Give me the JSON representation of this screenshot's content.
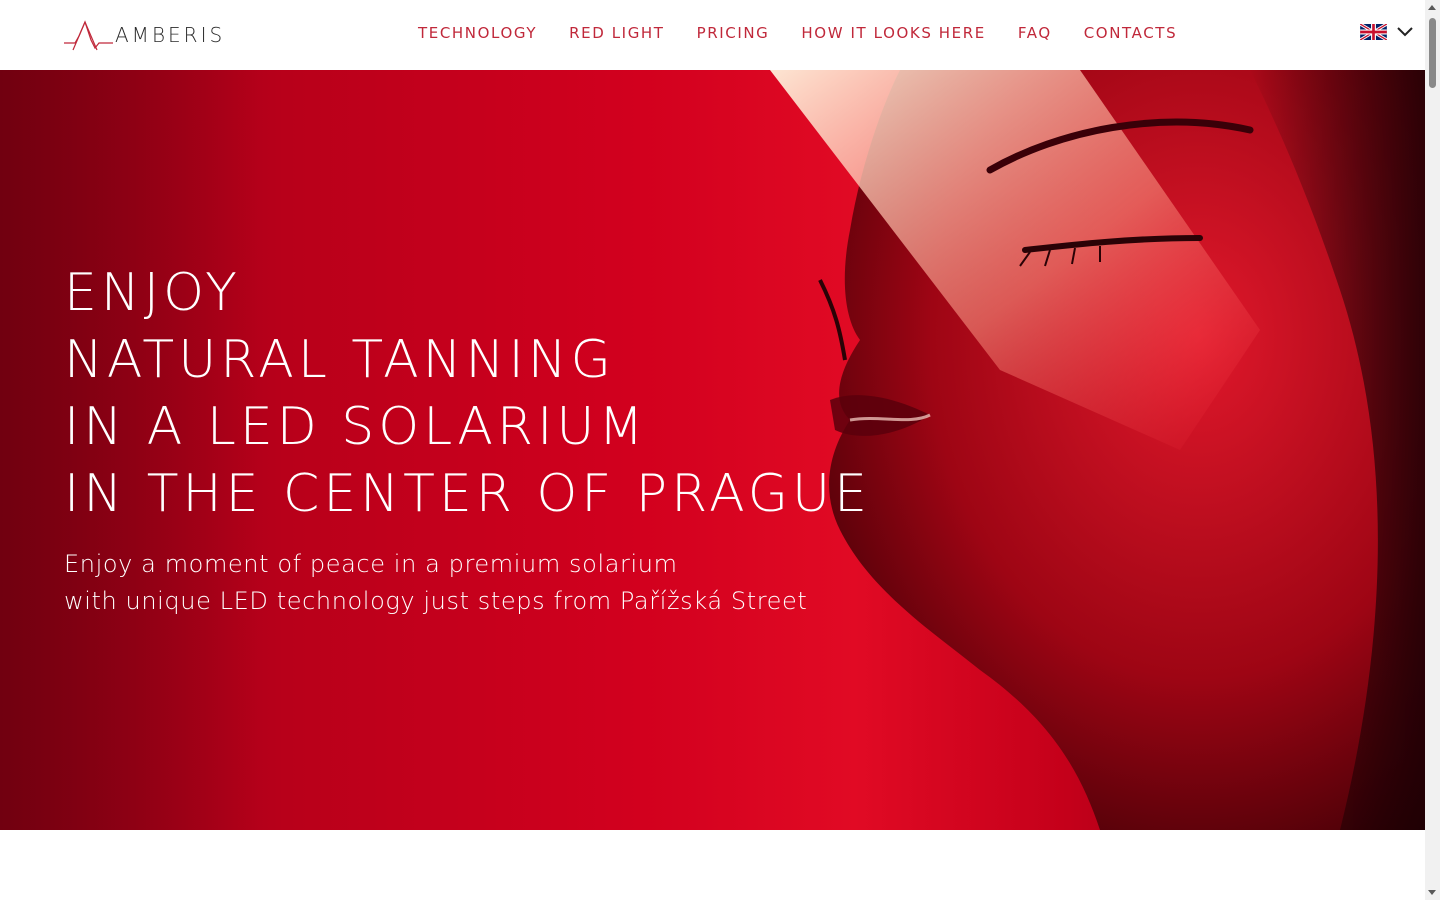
{
  "brand": {
    "name": "AMBERIS",
    "accent_color": "#c0283a",
    "logo_icon": "amberis-logo-icon"
  },
  "nav": {
    "items": [
      {
        "label": "TECHNOLOGY"
      },
      {
        "label": "RED LIGHT"
      },
      {
        "label": "PRICING"
      },
      {
        "label": "HOW IT LOOKS HERE"
      },
      {
        "label": "FAQ"
      },
      {
        "label": "CONTACTS"
      }
    ]
  },
  "language": {
    "flag_icon": "uk-flag-icon",
    "dropdown_icon": "chevron-down-icon"
  },
  "hero": {
    "title_lines": [
      "ENJOY",
      "NATURAL TANNING",
      "IN A LED SOLARIUM",
      "IN THE CENTER OF PRAGUE"
    ],
    "subtitle_lines": [
      "Enjoy a moment of peace in a premium solarium",
      "with unique LED technology just steps from Pařížská Street"
    ],
    "background_color": "#d2001e"
  }
}
